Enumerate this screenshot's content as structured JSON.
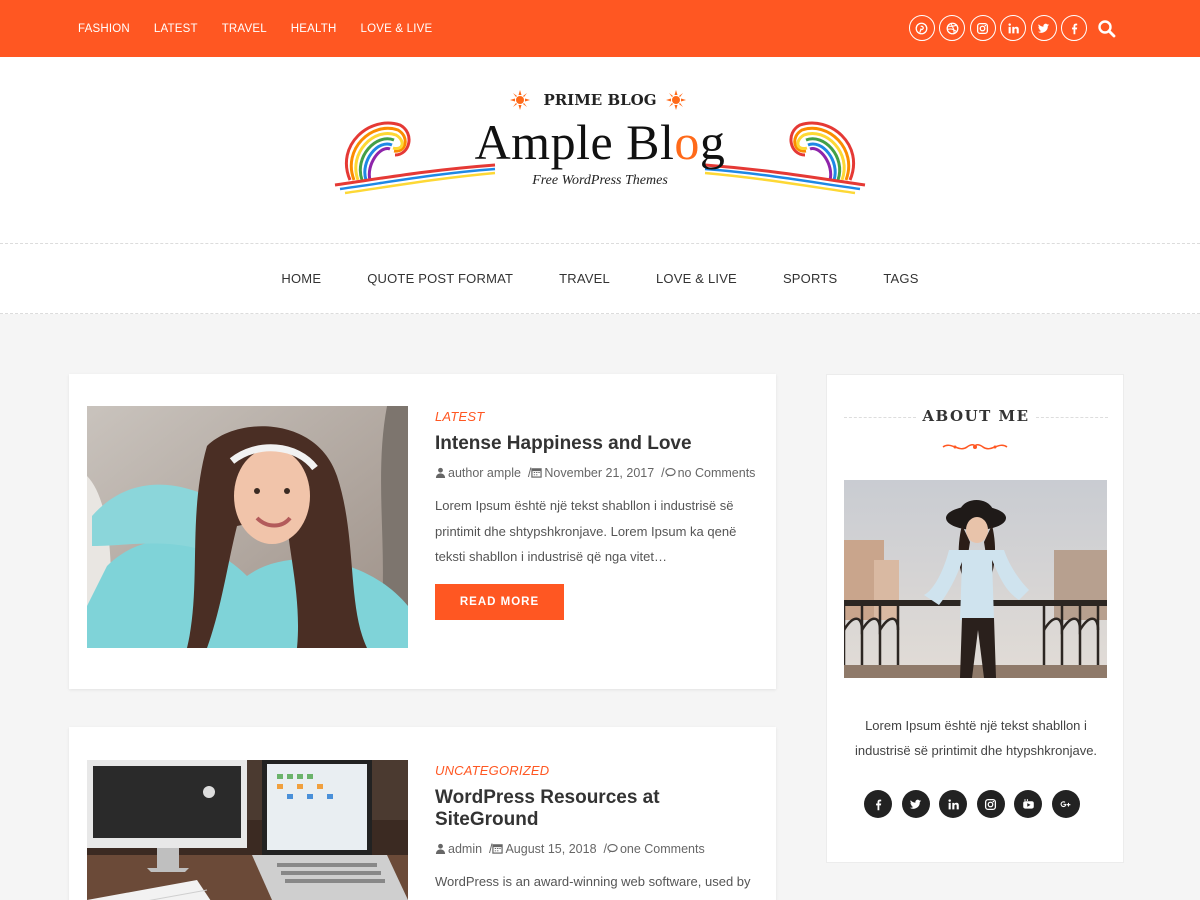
{
  "topbar": {
    "nav": [
      "FASHION",
      "LATEST",
      "TRAVEL",
      "HEALTH",
      "LOVE & LIVE"
    ],
    "social_icons": [
      "pinterest-icon",
      "dribbble-icon",
      "instagram-icon",
      "linkedin-icon",
      "twitter-icon",
      "facebook-icon"
    ],
    "search_icon": "search-icon",
    "color": "#ff5722"
  },
  "logo": {
    "prime": "PRIME BLOG",
    "title": "Ample Blog",
    "subtitle": "Free WordPress Themes"
  },
  "main_nav": [
    "HOME",
    "QUOTE POST FORMAT",
    "TRAVEL",
    "LOVE & LIVE",
    "SPORTS",
    "TAGS"
  ],
  "posts": [
    {
      "category": "LATEST",
      "title": "Intense Happiness and Love",
      "author": "author ample",
      "date": "November 21, 2017",
      "comments": "no Comments",
      "excerpt": "Lorem Ipsum është një tekst shabllon i industrisë së printimit dhe shtypshkronjave. Lorem Ipsum ka qenë teksti shabllon i industrisë që nga vitet…",
      "read_more": "READ MORE"
    },
    {
      "category": "UNCATEGORIZED",
      "title": "WordPress Resources at SiteGround",
      "author": "admin",
      "date": "August 15, 2018",
      "comments": "one Comments",
      "excerpt": "WordPress is an award-winning web software, used by millions of webmasters worldwide for building their"
    }
  ],
  "sidebar": {
    "about_title": "ABOUT ME",
    "about_text": "Lorem Ipsum është një tekst shabllon i industrisë së printimit dhe htypshkronjave.",
    "social_icons": [
      "facebook-icon",
      "twitter-icon",
      "linkedin-icon",
      "instagram-icon",
      "youtube-icon",
      "google-plus-icon"
    ]
  },
  "colors": {
    "accent": "#ff5722",
    "background": "#f5f5f5",
    "dark_icon": "#222222"
  }
}
